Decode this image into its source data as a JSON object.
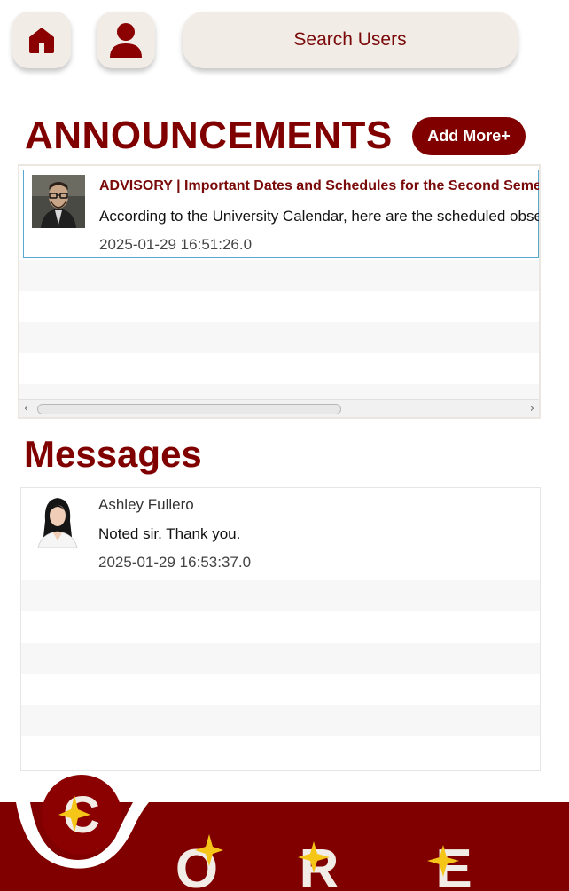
{
  "nav": {
    "home_icon": "home-icon",
    "profile_icon": "user-icon",
    "search_label": "Search Users"
  },
  "announcements": {
    "title": "ANNOUNCEMENTS",
    "add_label": "Add More+",
    "items": [
      {
        "title": "ADVISORY | Important Dates and Schedules for the Second Semester",
        "body": "According to the University Calendar, here are the scheduled observances and dates to remember",
        "timestamp": "2025-01-29 16:51:26.0"
      }
    ]
  },
  "messages": {
    "title": "Messages",
    "items": [
      {
        "sender": "Ashley Fullero",
        "body": "Noted sir. Thank you.",
        "timestamp": "2025-01-29 16:53:37.0"
      }
    ]
  },
  "footer": {
    "logo_letters": [
      "C",
      "O",
      "R",
      "E"
    ]
  },
  "colors": {
    "brand": "#800000",
    "button_bg": "#f2ece7",
    "selection_border": "#5aa8d2"
  }
}
